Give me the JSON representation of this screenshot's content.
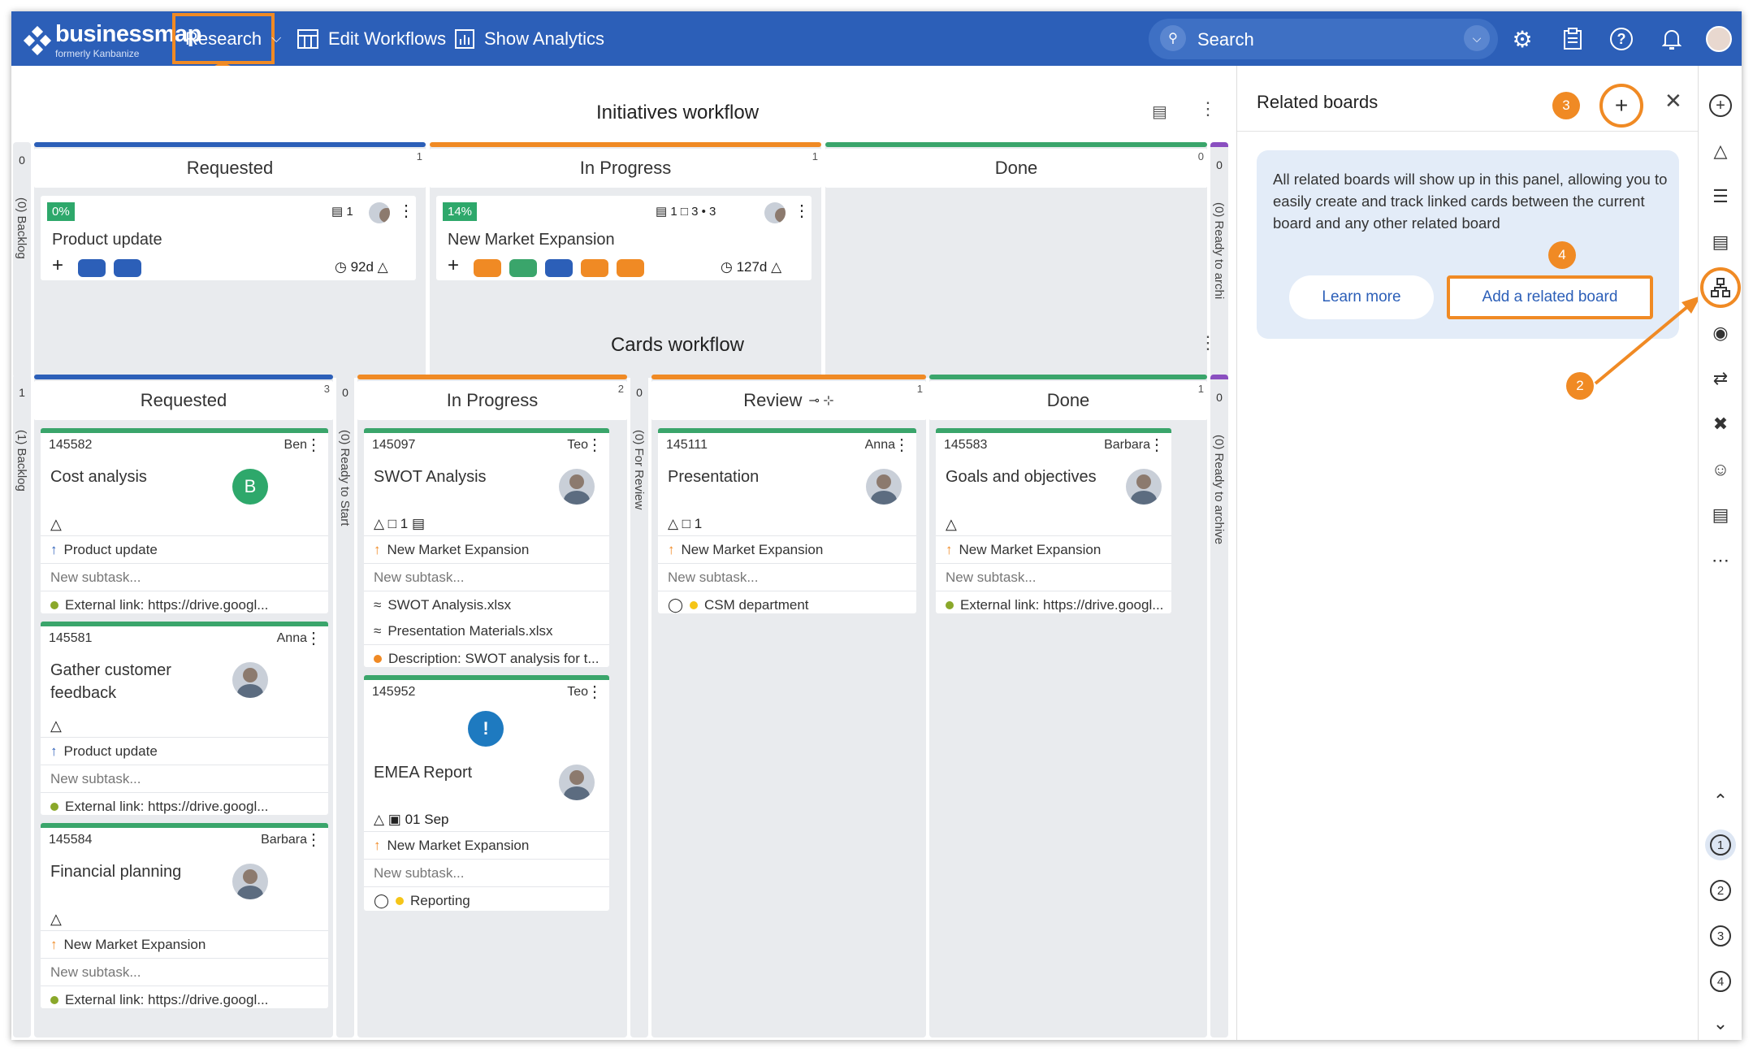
{
  "topbar": {
    "logo": "businessmap",
    "logo_sub": "formerly Kanbanize",
    "workspace": "Research",
    "edit_workflows": "Edit Workflows",
    "show_analytics": "Show Analytics",
    "search_placeholder": "Search"
  },
  "annotations": [
    "1",
    "2",
    "3",
    "4"
  ],
  "initiatives": {
    "title": "Initiatives workflow",
    "backlog": "(0) Backlog",
    "ready": "(0) Ready to archi",
    "zero": "0",
    "columns": [
      {
        "name": "Requested",
        "count": "1",
        "color": "#2c5fb8"
      },
      {
        "name": "In Progress",
        "count": "1",
        "color": "#f08a24"
      },
      {
        "name": "Done",
        "count": "0",
        "color": "#3aa56b"
      }
    ],
    "cards": [
      {
        "pct": "0%",
        "title": "Product update",
        "links": "1",
        "age": "92d"
      },
      {
        "pct": "14%",
        "title": "New Market Expansion",
        "links": "1",
        "comments": "3",
        "attachments": "3",
        "age": "127d"
      }
    ]
  },
  "cards_wf": {
    "title": "Cards workflow",
    "backlog": "(1) Backlog",
    "backlog_num": "1",
    "ready_start": "(0) Ready to Start",
    "for_review": "(0) For Review",
    "ready_archive": "(0) Ready to archive",
    "zero": "0",
    "columns": [
      {
        "name": "Requested",
        "count": "3",
        "color": "#2c5fb8"
      },
      {
        "name": "In Progress",
        "count": "2",
        "color": "#f08a24"
      },
      {
        "name": "Review",
        "count": "1",
        "color": "#f08a24"
      },
      {
        "name": "Done",
        "count": "1",
        "color": "#3aa56b"
      }
    ],
    "cards": [
      {
        "id": "145582",
        "owner": "Ben",
        "title": "Cost analysis",
        "avatar": "B",
        "parent": "Product update",
        "subtask": "New subtask...",
        "extra": "External link: https://drive.googl..."
      },
      {
        "id": "145581",
        "owner": "Anna",
        "title": "Gather customer feedback",
        "parent": "Product update",
        "subtask": "New subtask...",
        "extra": "External link: https://drive.googl..."
      },
      {
        "id": "145584",
        "owner": "Barbara",
        "title": "Financial planning",
        "parent": "New Market Expansion",
        "subtask": "New subtask...",
        "extra": "External link: https://drive.googl..."
      },
      {
        "id": "145097",
        "owner": "Teo",
        "title": "SWOT Analysis",
        "comments": "1",
        "parent": "New Market Expansion",
        "subtask": "New subtask...",
        "att1": "SWOT Analysis.xlsx",
        "att2": "Presentation Materials.xlsx",
        "extra": "Description: SWOT analysis for t..."
      },
      {
        "id": "145952",
        "owner": "Teo",
        "title": "EMEA Report",
        "date": "01 Sep",
        "parent": "New Market Expansion",
        "subtask": "New subtask...",
        "tag": "Reporting"
      },
      {
        "id": "145111",
        "owner": "Anna",
        "title": "Presentation",
        "comments": "1",
        "parent": "New Market Expansion",
        "subtask": "New subtask...",
        "tag": "CSM department"
      },
      {
        "id": "145583",
        "owner": "Barbara",
        "title": "Goals and objectives",
        "parent": "New Market Expansion",
        "subtask": "New subtask...",
        "extra": "External link: https://drive.googl..."
      }
    ]
  },
  "panel": {
    "title": "Related boards",
    "info": "All related boards will show up in this panel, allowing you to easily create and track linked cards between the current board and any other related board",
    "learn_more": "Learn more",
    "add_board": "Add a related board"
  },
  "colors": {
    "brand": "#2c5fb8",
    "accent": "#f08a24",
    "done": "#3aa56b"
  }
}
